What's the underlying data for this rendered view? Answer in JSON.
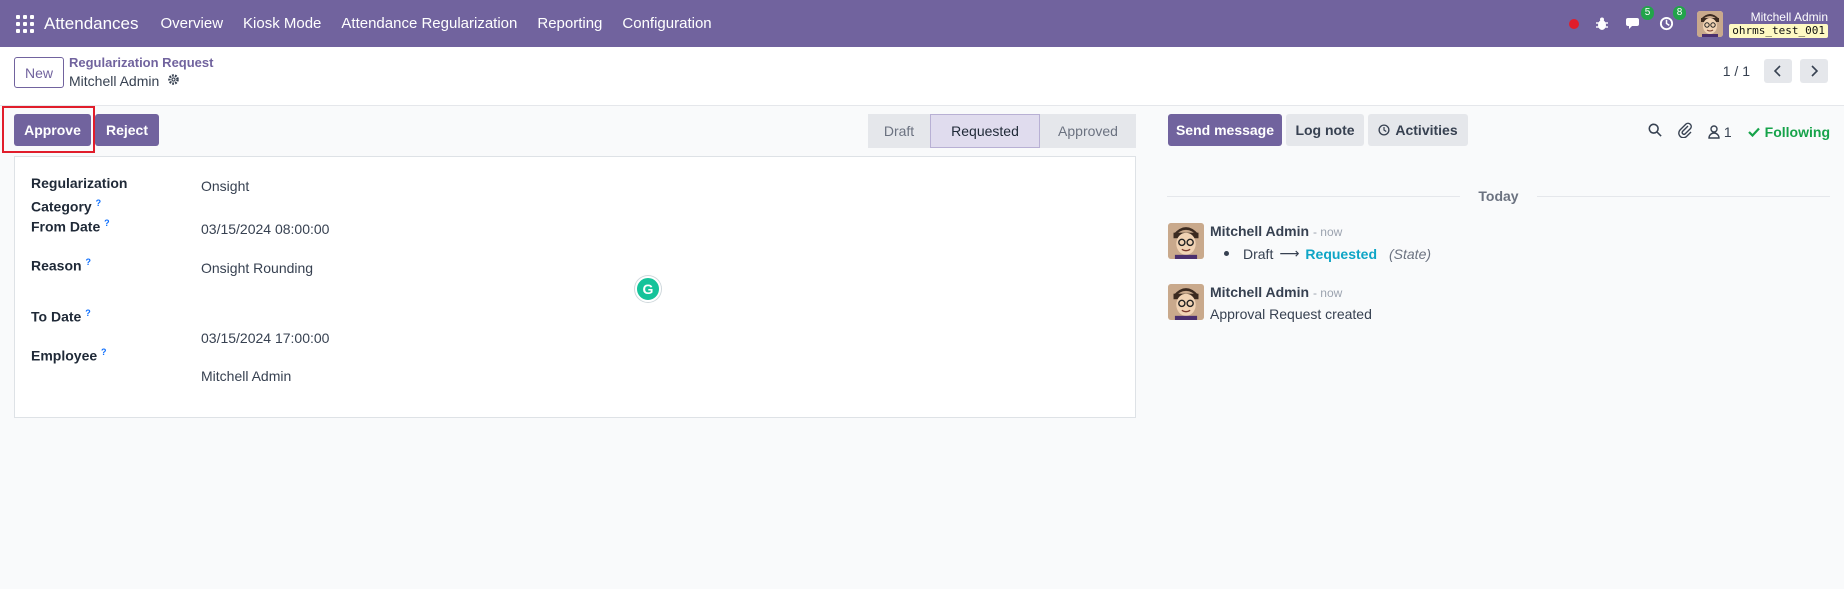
{
  "navbar": {
    "app_name": "Attendances",
    "menu": [
      "Overview",
      "Kiosk Mode",
      "Attendance Regularization",
      "Reporting",
      "Configuration"
    ],
    "messages_count": "5",
    "activities_count": "8",
    "user_name": "Mitchell Admin",
    "database": "ohrms_test_001"
  },
  "control": {
    "new_label": "New",
    "breadcrumb_parent": "Regularization Request",
    "breadcrumb_current": "Mitchell Admin",
    "pager_value": "1 / 1"
  },
  "actions": {
    "approve_label": "Approve",
    "reject_label": "Reject"
  },
  "statusbar": {
    "stages": [
      "Draft",
      "Requested",
      "Approved"
    ],
    "active": "Requested"
  },
  "form": {
    "category_label_line1": "Regularization",
    "category_label_line2": "Category",
    "category_value": "Onsight",
    "from_date_label": "From Date",
    "from_date_value": "03/15/2024 08:00:00",
    "reason_label": "Reason",
    "reason_value": "Onsight Rounding",
    "to_date_label": "To Date",
    "to_date_value": "03/15/2024 17:00:00",
    "employee_label": "Employee",
    "employee_value": "Mitchell Admin",
    "help_mark": "?",
    "grammarly_letter": "G"
  },
  "chatter": {
    "send_message_label": "Send message",
    "log_note_label": "Log note",
    "activities_label": "Activities",
    "followers_count": "1",
    "following_label": "Following",
    "date_separator": "Today",
    "messages": [
      {
        "author": "Mitchell Admin",
        "when": "- now",
        "old_value": "Draft",
        "arrow": "⟶",
        "new_value": "Requested",
        "field": "(State)"
      },
      {
        "author": "Mitchell Admin",
        "when": "- now",
        "body": "Approval Request created"
      }
    ]
  },
  "colors": {
    "brand": "#71639e",
    "highlight": "#e11d2b",
    "following": "#16a34a",
    "badge": "#22a44a"
  }
}
